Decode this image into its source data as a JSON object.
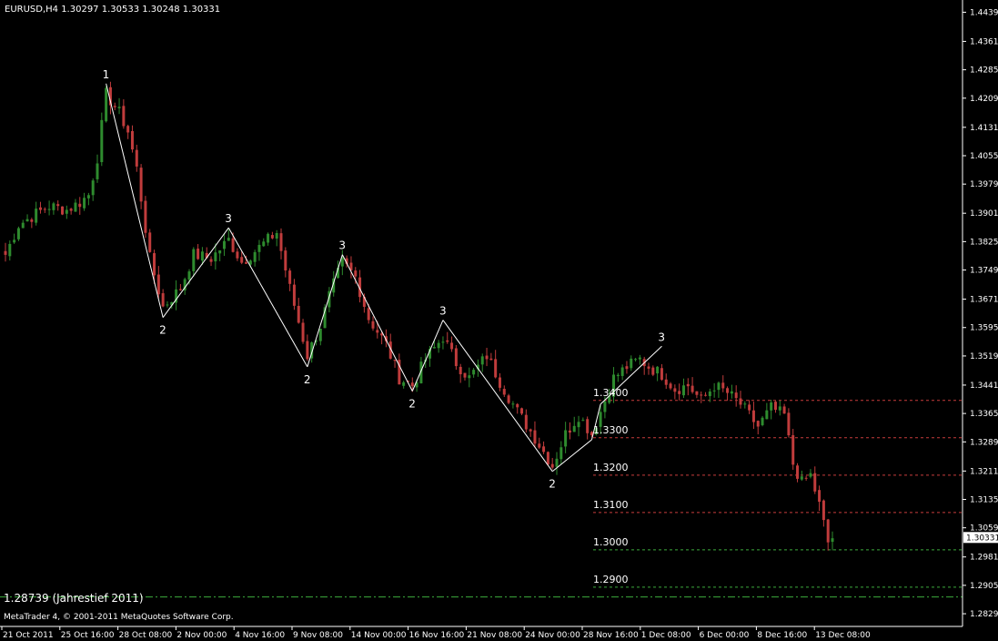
{
  "header": {
    "symbol_info": "EURUSD,H4  1.30297 1.30533 1.30248 1.30331"
  },
  "footer": {
    "copyright": "MetaTrader 4, © 2001-2011 MetaQuotes Software Corp."
  },
  "annotation": {
    "yearly_low": "1.28739 (Jahrestief 2011)"
  },
  "colors": {
    "background": "#000000",
    "bull": "#2e8b2e",
    "bear": "#c03c3c",
    "wave": "#ffffff",
    "level_red": "#c83c3c",
    "level_green": "#3caa3c",
    "axis": "#ffffff"
  },
  "chart_data": {
    "type": "candlestick",
    "symbol": "EURUSD",
    "timeframe": "H4",
    "last_price": "1.30331",
    "y_ticks": [
      "1.44390",
      "1.43610",
      "1.42850",
      "1.42090",
      "1.41310",
      "1.40550",
      "1.39790",
      "1.39010",
      "1.38250",
      "1.37490",
      "1.36710",
      "1.35950",
      "1.35190",
      "1.34410",
      "1.33650",
      "1.32890",
      "1.32110",
      "1.31350",
      "1.30590",
      "1.29810",
      "1.29050",
      "1.28290"
    ],
    "x_ticks": [
      "21 Oct 2011",
      "25 Oct 16:00",
      "28 Oct 08:00",
      "2 Nov 00:00",
      "4 Nov 16:00",
      "9 Nov 08:00",
      "14 Nov 00:00",
      "16 Nov 16:00",
      "21 Nov 08:00",
      "24 Nov 00:00",
      "28 Nov 16:00",
      "1 Dec 08:00",
      "6 Dec 00:00",
      "8 Dec 16:00",
      "13 Dec 08:00"
    ],
    "ylim": [
      1.2795,
      1.4462
    ],
    "levels": [
      {
        "value": 1.34,
        "label": "1.3400",
        "color": "red"
      },
      {
        "value": 1.33,
        "label": "1.3300",
        "color": "red"
      },
      {
        "value": 1.32,
        "label": "1.3200",
        "color": "red"
      },
      {
        "value": 1.31,
        "label": "1.3100",
        "color": "red"
      },
      {
        "value": 1.3,
        "label": "1.3000",
        "color": "green"
      },
      {
        "value": 1.29,
        "label": "1.2900",
        "color": "green"
      },
      {
        "value": 1.28739,
        "label": "",
        "color": "green-dashdot"
      }
    ],
    "wave_points": [
      {
        "bar": 23,
        "price": 1.4248,
        "label": "1"
      },
      {
        "bar": 36,
        "price": 1.3622,
        "label": "2"
      },
      {
        "bar": 51,
        "price": 1.3862,
        "label": "3"
      },
      {
        "bar": 69,
        "price": 1.349,
        "label": "2"
      },
      {
        "bar": 77,
        "price": 1.379,
        "label": "3"
      },
      {
        "bar": 93,
        "price": 1.3425,
        "label": "2"
      },
      {
        "bar": 100,
        "price": 1.3615,
        "label": "3"
      },
      {
        "bar": 125,
        "price": 1.321,
        "label": "2"
      },
      {
        "bar": 134,
        "price": 1.3295,
        "label": ""
      },
      {
        "bar": 136,
        "price": 1.339,
        "label": ""
      },
      {
        "bar": 150,
        "price": 1.3545,
        "label": "3"
      }
    ],
    "close_anchors": [
      [
        0,
        1.379
      ],
      [
        3,
        1.387
      ],
      [
        7,
        1.39
      ],
      [
        10,
        1.392
      ],
      [
        14,
        1.391
      ],
      [
        17,
        1.393
      ],
      [
        19,
        1.395
      ],
      [
        21,
        1.405
      ],
      [
        23,
        1.422
      ],
      [
        26,
        1.417
      ],
      [
        28,
        1.412
      ],
      [
        30,
        1.402
      ],
      [
        33,
        1.378
      ],
      [
        36,
        1.365
      ],
      [
        40,
        1.37
      ],
      [
        43,
        1.379
      ],
      [
        47,
        1.378
      ],
      [
        51,
        1.383
      ],
      [
        54,
        1.377
      ],
      [
        58,
        1.381
      ],
      [
        62,
        1.385
      ],
      [
        65,
        1.37
      ],
      [
        69,
        1.352
      ],
      [
        72,
        1.36
      ],
      [
        74,
        1.368
      ],
      [
        77,
        1.377
      ],
      [
        80,
        1.373
      ],
      [
        83,
        1.362
      ],
      [
        87,
        1.355
      ],
      [
        90,
        1.346
      ],
      [
        93,
        1.344
      ],
      [
        96,
        1.351
      ],
      [
        100,
        1.357
      ],
      [
        103,
        1.35
      ],
      [
        106,
        1.346
      ],
      [
        110,
        1.352
      ],
      [
        113,
        1.345
      ],
      [
        117,
        1.337
      ],
      [
        121,
        1.33
      ],
      [
        125,
        1.3225
      ],
      [
        128,
        1.331
      ],
      [
        131,
        1.336
      ],
      [
        134,
        1.331
      ],
      [
        136,
        1.337
      ],
      [
        139,
        1.346
      ],
      [
        142,
        1.349
      ],
      [
        145,
        1.351
      ],
      [
        147,
        1.349
      ],
      [
        150,
        1.347
      ],
      [
        153,
        1.343
      ],
      [
        156,
        1.344
      ],
      [
        159,
        1.34
      ],
      [
        162,
        1.344
      ],
      [
        165,
        1.342
      ],
      [
        168,
        1.339
      ],
      [
        172,
        1.333
      ],
      [
        175,
        1.338
      ],
      [
        178,
        1.336
      ],
      [
        180,
        1.323
      ],
      [
        182,
        1.318
      ],
      [
        184,
        1.32
      ],
      [
        186,
        1.312
      ],
      [
        188,
        1.302
      ],
      [
        189,
        1.3033
      ]
    ],
    "bar_count": 190
  }
}
